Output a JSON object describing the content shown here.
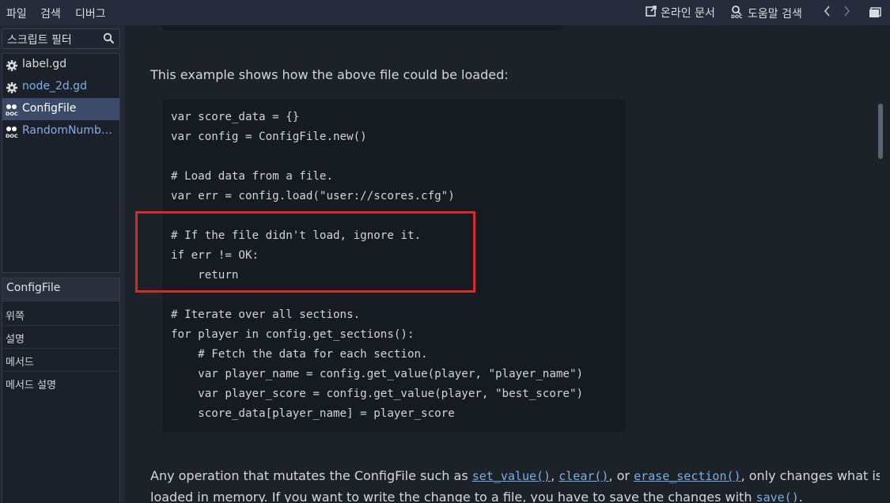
{
  "menu": {
    "file": "파일",
    "search": "검색",
    "debug": "디버그"
  },
  "toolbar": {
    "online_docs": "온라인 문서",
    "help_search": "도움말 검색",
    "back_icon": "chevron-left",
    "forward_icon": "chevron-right",
    "window_icon": "distraction-free"
  },
  "sidebar": {
    "filter_placeholder": "스크립트 필터",
    "scripts": [
      {
        "label": "label.gd",
        "icon": "gear-icon",
        "color": "#d9dbde"
      },
      {
        "label": "node_2d.gd",
        "icon": "gear-icon",
        "color": "#7fb0e8"
      },
      {
        "label": "ConfigFile",
        "icon": "doc-icon",
        "color": "#ffffff",
        "selected": true
      },
      {
        "label": "RandomNumberGenerator",
        "icon": "doc-icon",
        "color": "#7fb0e8"
      }
    ],
    "outline_title": "ConfigFile",
    "outline": [
      "위쪽",
      "설명",
      "메서드",
      "메서드 설명"
    ]
  },
  "doc": {
    "intro": "This example shows how the above file could be loaded:",
    "code": "var score_data = {}\nvar config = ConfigFile.new()\n\n# Load data from a file.\nvar err = config.load(\"user://scores.cfg\")\n\n# If the file didn't load, ignore it.\nif err != OK:\n    return\n\n# Iterate over all sections.\nfor player in config.get_sections():\n    # Fetch the data for each section.\n    var player_name = config.get_value(player, \"player_name\")\n    var player_score = config.get_value(player, \"best_score\")\n    score_data[player_name] = player_score",
    "para2_part1": "Any operation that mutates the ConfigFile such as ",
    "link_set_value": "set_value()",
    "sep1": ", ",
    "link_clear": "clear()",
    "sep2": ", or ",
    "link_erase_section": "erase_section()",
    "para2_part2": ", only changes what is",
    "para3_part1": "loaded in memory. If you want to write the change to a file, you have to save the changes with ",
    "link_save": "save()",
    "para3_part2": "."
  },
  "colors": {
    "highlight": "#d42a2a",
    "link": "#78aee8",
    "selected_bg": "#3a4a68"
  }
}
